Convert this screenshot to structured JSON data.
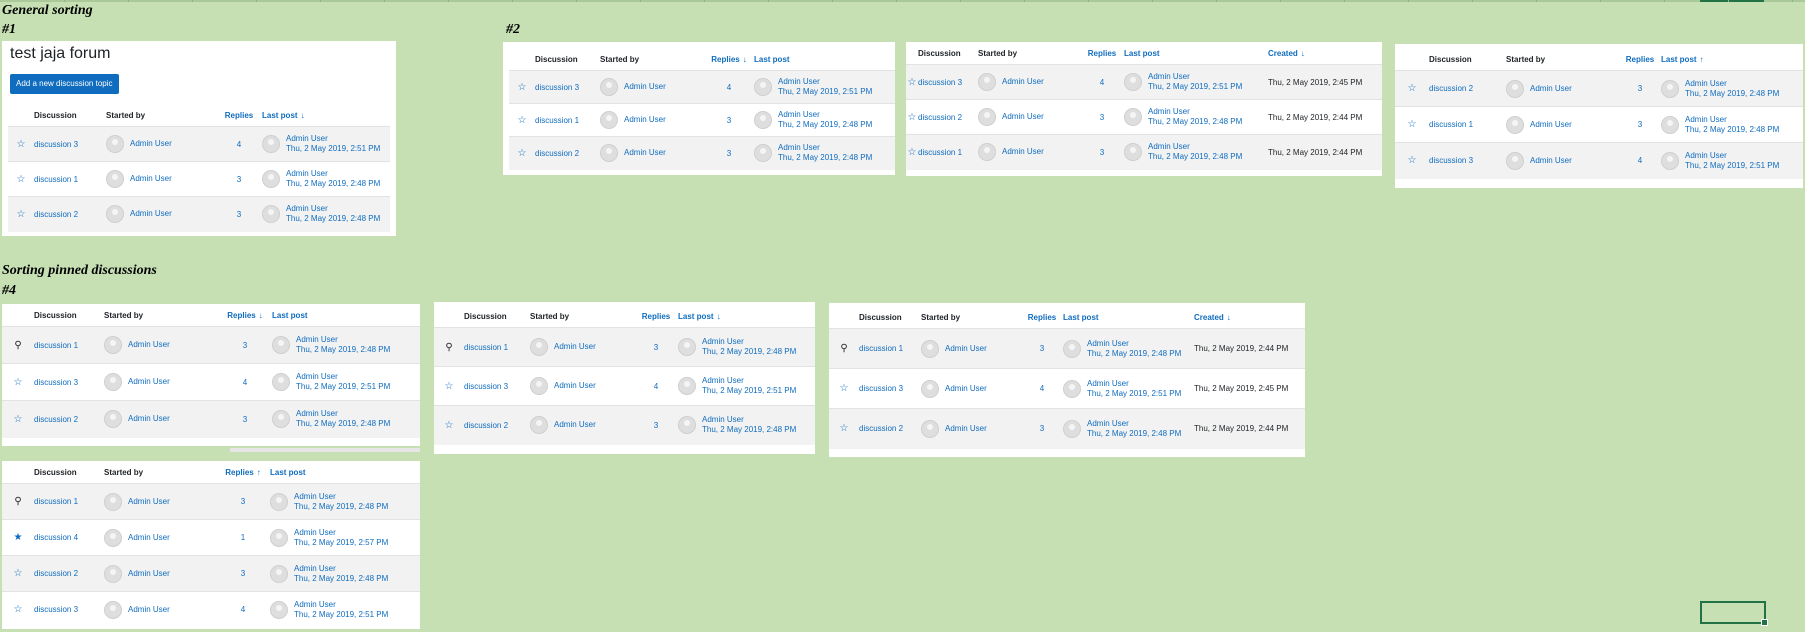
{
  "headings": {
    "general": "General sorting",
    "n1": "#1",
    "n2": "#2",
    "pinned": "Sorting pinned discussions",
    "n4": "#4"
  },
  "forum": {
    "title": "test jaja forum",
    "add_button": "Add a new discussion topic"
  },
  "columns": {
    "discussion": "Discussion",
    "started_by": "Started by",
    "replies": "Replies",
    "last_post": "Last post",
    "created": "Created"
  },
  "arrows": {
    "down": "↓",
    "up": "↑"
  },
  "colors": {
    "background": "#c6e0b4",
    "link": "#0f6cbf",
    "button": "#0f6cbf",
    "row_alt": "#f2f2f2"
  },
  "tables": [
    {
      "id": "t1",
      "rows": [
        {
          "icon": "star",
          "discussion": "discussion 3",
          "starter": "Admin User",
          "replies": "4",
          "lp_user": "Admin User",
          "lp_date": "Thu, 2 May 2019, 2:51 PM"
        },
        {
          "icon": "star",
          "discussion": "discussion 1",
          "starter": "Admin User",
          "replies": "3",
          "lp_user": "Admin User",
          "lp_date": "Thu, 2 May 2019, 2:48 PM"
        },
        {
          "icon": "star",
          "discussion": "discussion 2",
          "starter": "Admin User",
          "replies": "3",
          "lp_user": "Admin User",
          "lp_date": "Thu, 2 May 2019, 2:48 PM"
        }
      ]
    },
    {
      "id": "t2",
      "rows": [
        {
          "icon": "star",
          "discussion": "discussion 3",
          "starter": "Admin User",
          "replies": "4",
          "lp_user": "Admin User",
          "lp_date": "Thu, 2 May 2019, 2:51 PM"
        },
        {
          "icon": "star",
          "discussion": "discussion 1",
          "starter": "Admin User",
          "replies": "3",
          "lp_user": "Admin User",
          "lp_date": "Thu, 2 May 2019, 2:48 PM"
        },
        {
          "icon": "star",
          "discussion": "discussion 2",
          "starter": "Admin User",
          "replies": "3",
          "lp_user": "Admin User",
          "lp_date": "Thu, 2 May 2019, 2:48 PM"
        }
      ]
    },
    {
      "id": "t3",
      "rows": [
        {
          "icon": "star",
          "discussion": "discussion 3",
          "starter": "Admin User",
          "replies": "4",
          "lp_user": "Admin User",
          "lp_date": "Thu, 2 May 2019, 2:51 PM",
          "created": "Thu, 2 May 2019, 2:45 PM"
        },
        {
          "icon": "star",
          "discussion": "discussion 2",
          "starter": "Admin User",
          "replies": "3",
          "lp_user": "Admin User",
          "lp_date": "Thu, 2 May 2019, 2:48 PM",
          "created": "Thu, 2 May 2019, 2:44 PM"
        },
        {
          "icon": "star",
          "discussion": "discussion 1",
          "starter": "Admin User",
          "replies": "3",
          "lp_user": "Admin User",
          "lp_date": "Thu, 2 May 2019, 2:48 PM",
          "created": "Thu, 2 May 2019, 2:44 PM"
        }
      ]
    },
    {
      "id": "t4",
      "rows": [
        {
          "icon": "star",
          "discussion": "discussion 2",
          "starter": "Admin User",
          "replies": "3",
          "lp_user": "Admin User",
          "lp_date": "Thu, 2 May 2019, 2:48 PM"
        },
        {
          "icon": "star",
          "discussion": "discussion 1",
          "starter": "Admin User",
          "replies": "3",
          "lp_user": "Admin User",
          "lp_date": "Thu, 2 May 2019, 2:48 PM"
        },
        {
          "icon": "star",
          "discussion": "discussion 3",
          "starter": "Admin User",
          "replies": "4",
          "lp_user": "Admin User",
          "lp_date": "Thu, 2 May 2019, 2:51 PM"
        }
      ]
    },
    {
      "id": "t5",
      "rows": [
        {
          "icon": "pin",
          "discussion": "discussion 1",
          "starter": "Admin User",
          "replies": "3",
          "lp_user": "Admin User",
          "lp_date": "Thu, 2 May 2019, 2:48 PM"
        },
        {
          "icon": "star",
          "discussion": "discussion 3",
          "starter": "Admin User",
          "replies": "4",
          "lp_user": "Admin User",
          "lp_date": "Thu, 2 May 2019, 2:51 PM"
        },
        {
          "icon": "star",
          "discussion": "discussion 2",
          "starter": "Admin User",
          "replies": "3",
          "lp_user": "Admin User",
          "lp_date": "Thu, 2 May 2019, 2:48 PM"
        }
      ]
    },
    {
      "id": "t6",
      "rows": [
        {
          "icon": "pin",
          "discussion": "discussion 1",
          "starter": "Admin User",
          "replies": "3",
          "lp_user": "Admin User",
          "lp_date": "Thu, 2 May 2019, 2:48 PM"
        },
        {
          "icon": "star",
          "discussion": "discussion 3",
          "starter": "Admin User",
          "replies": "4",
          "lp_user": "Admin User",
          "lp_date": "Thu, 2 May 2019, 2:51 PM"
        },
        {
          "icon": "star",
          "discussion": "discussion 2",
          "starter": "Admin User",
          "replies": "3",
          "lp_user": "Admin User",
          "lp_date": "Thu, 2 May 2019, 2:48 PM"
        }
      ]
    },
    {
      "id": "t7",
      "rows": [
        {
          "icon": "pin",
          "discussion": "discussion 1",
          "starter": "Admin User",
          "replies": "3",
          "lp_user": "Admin User",
          "lp_date": "Thu, 2 May 2019, 2:48 PM",
          "created": "Thu, 2 May 2019, 2:44 PM"
        },
        {
          "icon": "star",
          "discussion": "discussion 3",
          "starter": "Admin User",
          "replies": "4",
          "lp_user": "Admin User",
          "lp_date": "Thu, 2 May 2019, 2:51 PM",
          "created": "Thu, 2 May 2019, 2:45 PM"
        },
        {
          "icon": "star",
          "discussion": "discussion 2",
          "starter": "Admin User",
          "replies": "3",
          "lp_user": "Admin User",
          "lp_date": "Thu, 2 May 2019, 2:48 PM",
          "created": "Thu, 2 May 2019, 2:44 PM"
        }
      ]
    },
    {
      "id": "t8",
      "rows": [
        {
          "icon": "pin",
          "discussion": "discussion 1",
          "starter": "Admin User",
          "replies": "3",
          "lp_user": "Admin User",
          "lp_date": "Thu, 2 May 2019, 2:48 PM"
        },
        {
          "icon": "star-filled",
          "discussion": "discussion 4",
          "starter": "Admin User",
          "replies": "1",
          "lp_user": "Admin User",
          "lp_date": "Thu, 2 May 2019, 2:57 PM"
        },
        {
          "icon": "star",
          "discussion": "discussion 2",
          "starter": "Admin User",
          "replies": "3",
          "lp_user": "Admin User",
          "lp_date": "Thu, 2 May 2019, 2:48 PM"
        },
        {
          "icon": "star",
          "discussion": "discussion 3",
          "starter": "Admin User",
          "replies": "4",
          "lp_user": "Admin User",
          "lp_date": "Thu, 2 May 2019, 2:51 PM"
        }
      ]
    }
  ]
}
